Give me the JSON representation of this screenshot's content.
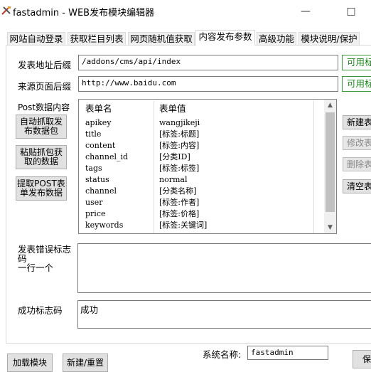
{
  "window": {
    "title": "fastadmin - WEB发布模块编辑器",
    "minimize": "—",
    "maximize": "□"
  },
  "tabs": [
    {
      "label": "网站自动登录"
    },
    {
      "label": "获取栏目列表"
    },
    {
      "label": "网页随机值获取"
    },
    {
      "label": "内容发布参数"
    },
    {
      "label": "高级功能"
    },
    {
      "label": "模块说明/保护"
    }
  ],
  "form": {
    "publish_url_label": "发表地址后缀",
    "publish_url_value": "/addons/cms/api/index",
    "source_url_label": "来源页面后缀",
    "source_url_value": "http://www.baidu.com",
    "available_tags_button": "可用标",
    "post_data_label": "Post数据内容",
    "error_label": "发表错误标志码\n一行一个",
    "error_value": "",
    "success_label": "成功标志码",
    "success_value": "成功",
    "system_name_label": "系统名称:",
    "system_name_value": "fastadmin"
  },
  "left_buttons": {
    "auto_capture": "自动抓取发\n布数据包",
    "paste_capture": "粘贴抓包获\n取的数据",
    "extract_post": "提取POST表\n单发布数据"
  },
  "right_buttons": {
    "new": "新建表",
    "edit": "修改表",
    "delete": "删除表",
    "clear": "清空表"
  },
  "bottom_buttons": {
    "load_module": "加载模块",
    "new_reset": "新建/重置",
    "save": "保"
  },
  "table": {
    "columns": [
      "表单名",
      "表单值"
    ],
    "rows": [
      {
        "name": "apikey",
        "value": "wangjikeji"
      },
      {
        "name": "title",
        "value": "[标签:标题]"
      },
      {
        "name": "content",
        "value": "[标签:内容]"
      },
      {
        "name": "channel_id",
        "value": "[分类ID]"
      },
      {
        "name": "tags",
        "value": "[标签:标签]"
      },
      {
        "name": "status",
        "value": "normal"
      },
      {
        "name": "channel",
        "value": "[分类名称]"
      },
      {
        "name": "user",
        "value": "[标签:作者]"
      },
      {
        "name": "price",
        "value": "[标签:价格]"
      },
      {
        "name": "keywords",
        "value": "[标签:关键词]"
      }
    ]
  },
  "icons": {
    "app": "app-logo-icon",
    "scroll_up": "▲",
    "scroll_down": "▼"
  },
  "colors": {
    "green_accent": "#1a8a1a",
    "tab_bg": "#f0f0f0"
  }
}
